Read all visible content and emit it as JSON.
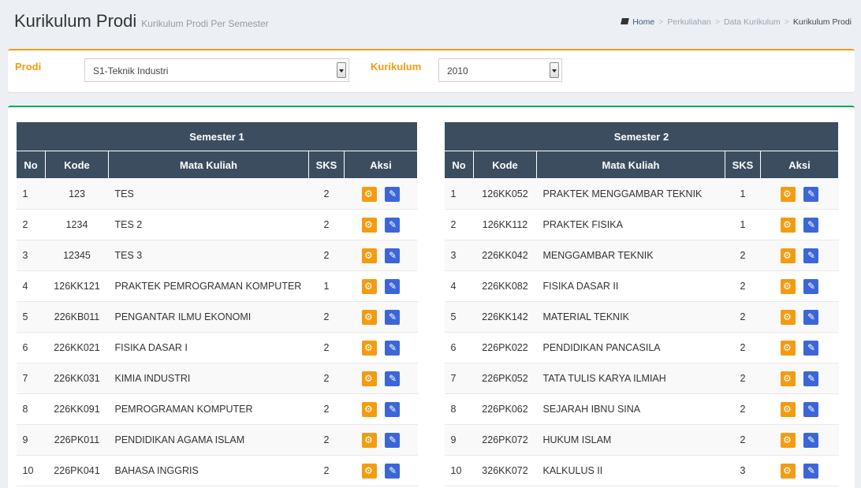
{
  "header": {
    "title": "Kurikulum Prodi",
    "subtitle": "Kurikulum Prodi Per Semester",
    "breadcrumb": [
      "Home",
      "Perkuliahan",
      "Data Kurikulum",
      "Kurikulum Prodi"
    ]
  },
  "filter": {
    "prodi_label": "Prodi",
    "prodi_value": "S1-Teknik Industri",
    "kurikulum_label": "Kurikulum",
    "kurikulum_value": "2010"
  },
  "columns": [
    "No",
    "Kode",
    "Mata Kuliah",
    "SKS",
    "Aksi"
  ],
  "semesters": [
    {
      "title": "Semester 1",
      "rows": [
        {
          "no": "1",
          "kode": "123",
          "mk": "TES",
          "sks": "2"
        },
        {
          "no": "2",
          "kode": "1234",
          "mk": "TES 2",
          "sks": "2"
        },
        {
          "no": "3",
          "kode": "12345",
          "mk": "TES 3",
          "sks": "2"
        },
        {
          "no": "4",
          "kode": "126KK121",
          "mk": "PRAKTEK PEMROGRAMAN KOMPUTER",
          "sks": "1"
        },
        {
          "no": "5",
          "kode": "226KB011",
          "mk": "PENGANTAR ILMU EKONOMI",
          "sks": "2"
        },
        {
          "no": "6",
          "kode": "226KK021",
          "mk": "FISIKA DASAR I",
          "sks": "2"
        },
        {
          "no": "7",
          "kode": "226KK031",
          "mk": "KIMIA INDUSTRI",
          "sks": "2"
        },
        {
          "no": "8",
          "kode": "226KK091",
          "mk": "PEMROGRAMAN KOMPUTER",
          "sks": "2"
        },
        {
          "no": "9",
          "kode": "226PK011",
          "mk": "PENDIDIKAN AGAMA ISLAM",
          "sks": "2"
        },
        {
          "no": "10",
          "kode": "226PK041",
          "mk": "BAHASA INGGRIS",
          "sks": "2"
        }
      ]
    },
    {
      "title": "Semester 2",
      "rows": [
        {
          "no": "1",
          "kode": "126KK052",
          "mk": "PRAKTEK MENGGAMBAR TEKNIK",
          "sks": "1"
        },
        {
          "no": "2",
          "kode": "126KK112",
          "mk": "PRAKTEK FISIKA",
          "sks": "1"
        },
        {
          "no": "3",
          "kode": "226KK042",
          "mk": "MENGGAMBAR TEKNIK",
          "sks": "2"
        },
        {
          "no": "4",
          "kode": "226KK082",
          "mk": "FISIKA DASAR II",
          "sks": "2"
        },
        {
          "no": "5",
          "kode": "226KK142",
          "mk": "MATERIAL TEKNIK",
          "sks": "2"
        },
        {
          "no": "6",
          "kode": "226PK022",
          "mk": "PENDIDIKAN PANCASILA",
          "sks": "2"
        },
        {
          "no": "7",
          "kode": "226PK052",
          "mk": "TATA TULIS KARYA ILMIAH",
          "sks": "2"
        },
        {
          "no": "8",
          "kode": "226PK062",
          "mk": "SEJARAH IBNU SINA",
          "sks": "2"
        },
        {
          "no": "9",
          "kode": "226PK072",
          "mk": "HUKUM ISLAM",
          "sks": "2"
        },
        {
          "no": "10",
          "kode": "326KK072",
          "mk": "KALKULUS II",
          "sks": "3"
        }
      ]
    }
  ],
  "icons": {
    "action_settings": "gears-icon",
    "action_edit": "pencil-icon",
    "breadcrumb_home": "book-icon"
  },
  "colors": {
    "accent_orange": "#f39c12",
    "accent_green": "#00a65a",
    "table_header": "#3c4d60",
    "edit_blue": "#3c66d8"
  }
}
